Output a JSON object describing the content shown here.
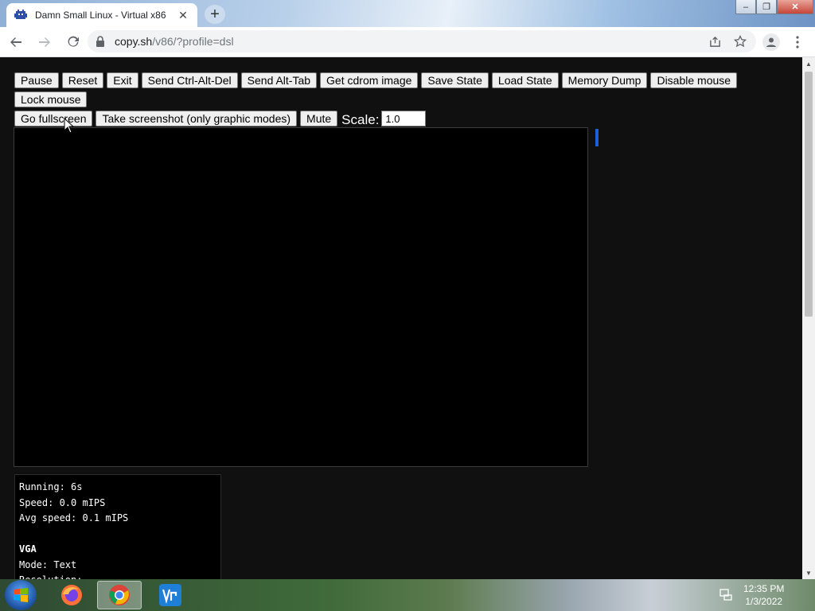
{
  "browser": {
    "tab": {
      "title": "Damn Small Linux - Virtual x86",
      "favicon": "v86-favicon-icon",
      "close": "✕"
    },
    "new_tab": "+",
    "window_controls": {
      "minimize": "‒",
      "maximize": "❐",
      "close": "✕"
    },
    "address": {
      "host": "copy.sh",
      "path": "/v86/?profile=dsl"
    }
  },
  "emulator": {
    "buttons": [
      "Pause",
      "Reset",
      "Exit",
      "Send Ctrl-Alt-Del",
      "Send Alt-Tab",
      "Get cdrom image",
      "Save State",
      "Load State",
      "Memory Dump",
      "Disable mouse",
      "Lock mouse",
      "Go fullscreen",
      "Take screenshot (only graphic modes)",
      "Mute"
    ],
    "scale": {
      "label": "Scale:",
      "value": "1.0"
    },
    "info": {
      "running": "Running: 6s",
      "speed": "Speed: 0.0 mIPS",
      "avg_speed": "Avg speed: 0.1 mIPS",
      "vga_heading": "VGA",
      "mode": "Mode: Text",
      "resolution": "Resolution:"
    }
  },
  "taskbar": {
    "apps": [
      "firefox-icon",
      "chrome-icon",
      "vnc-viewer-icon"
    ],
    "clock": {
      "time": "12:35 PM",
      "date": "1/3/2022"
    }
  },
  "colors": {
    "page_background": "#101010",
    "screen": "#000000",
    "accent_marker": "#1c5fd8"
  }
}
